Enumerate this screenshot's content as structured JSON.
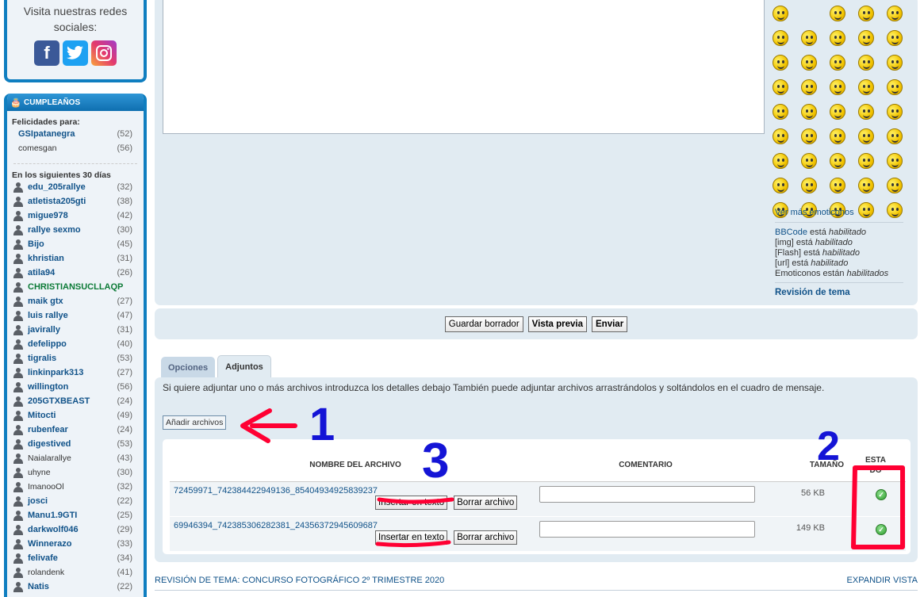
{
  "social": {
    "title": "Visita nuestras redes sociales:",
    "icons": [
      "facebook-icon",
      "twitter-icon",
      "instagram-icon"
    ]
  },
  "birthdays": {
    "header": "CUMPLEAÑOS",
    "today_title": "Felicidades para:",
    "today": [
      {
        "name": "GSIpatanegra",
        "age": "(52)"
      },
      {
        "name": "comesgan",
        "age": "(56)"
      }
    ],
    "upcoming_title": "En los siguientes 30 días",
    "upcoming": [
      {
        "name": "edu_205rallye",
        "age": "(32)",
        "style": "link"
      },
      {
        "name": "atletista205gti",
        "age": "(38)",
        "style": "link"
      },
      {
        "name": "migue978",
        "age": "(42)",
        "style": "link"
      },
      {
        "name": "rallye sexmo",
        "age": "(30)",
        "style": "link"
      },
      {
        "name": "Bijo",
        "age": "(45)",
        "style": "link"
      },
      {
        "name": "khristian",
        "age": "(31)",
        "style": "link"
      },
      {
        "name": "atila94",
        "age": "(26)",
        "style": "link"
      },
      {
        "name": "CHRISTIANSUCLLAQP",
        "age": "",
        "style": "green"
      },
      {
        "name": "maik gtx",
        "age": "(27)",
        "style": "link"
      },
      {
        "name": "luis rallye",
        "age": "(47)",
        "style": "link"
      },
      {
        "name": "javirally",
        "age": "(31)",
        "style": "link"
      },
      {
        "name": "defelippo",
        "age": "(40)",
        "style": "link"
      },
      {
        "name": "tigralis",
        "age": "(53)",
        "style": "link"
      },
      {
        "name": "linkinpark313",
        "age": "(27)",
        "style": "link"
      },
      {
        "name": "willington",
        "age": "(56)",
        "style": "link"
      },
      {
        "name": "205GTXBEAST",
        "age": "(24)",
        "style": "link"
      },
      {
        "name": "Mitocti",
        "age": "(49)",
        "style": "link"
      },
      {
        "name": "rubenfear",
        "age": "(24)",
        "style": "link"
      },
      {
        "name": "digestived",
        "age": "(53)",
        "style": "link"
      },
      {
        "name": "Naialarallye",
        "age": "(43)",
        "style": "plain"
      },
      {
        "name": "uhyne",
        "age": "(30)",
        "style": "plain"
      },
      {
        "name": "ImanooOl",
        "age": "(32)",
        "style": "plain"
      },
      {
        "name": "josci",
        "age": "(22)",
        "style": "link"
      },
      {
        "name": "Manu1.9GTI",
        "age": "(25)",
        "style": "link"
      },
      {
        "name": "darkwolf046",
        "age": "(29)",
        "style": "link"
      },
      {
        "name": "Winnerazo",
        "age": "(33)",
        "style": "link"
      },
      {
        "name": "felivafe",
        "age": "(34)",
        "style": "link"
      },
      {
        "name": "rolandenk",
        "age": "(41)",
        "style": "plain"
      },
      {
        "name": "Natis",
        "age": "(22)",
        "style": "link"
      }
    ]
  },
  "smilies": {
    "more_link": "Ver más emoticonos"
  },
  "bbcode": {
    "lines": [
      {
        "label": "BBCode",
        "text": " está ",
        "state": "habilitado",
        "link": true
      },
      {
        "label": "[img]",
        "text": " está ",
        "state": "habilitado",
        "link": false
      },
      {
        "label": "[Flash]",
        "text": " está ",
        "state": "habilitado",
        "link": false
      },
      {
        "label": "[url]",
        "text": " está ",
        "state": "habilitado",
        "link": false
      },
      {
        "label": "Emoticonos",
        "text": " están ",
        "state": "habilitados",
        "link": false
      }
    ],
    "topic_review": "Revisión de tema"
  },
  "buttons": {
    "save_draft": "Guardar borrador",
    "preview": "Vista previa",
    "submit": "Enviar"
  },
  "tabs": {
    "options": "Opciones",
    "attachments": "Adjuntos"
  },
  "attachments": {
    "help": "Si quiere adjuntar uno o más archivos introduzca los detalles debajo También puede adjuntar archivos arrastrándolos y soltándolos en el cuadro de mensaje.",
    "add_button": "Añadir archivos",
    "columns": {
      "filename": "NOMBRE DEL ARCHIVO",
      "comment": "COMENTARIO",
      "size": "TAMAÑO",
      "status": "ESTADO"
    },
    "files": [
      {
        "name": "72459971_742384422949136_8540493492583923 7",
        "size": "56 KB",
        "insert": "Insertar en texto",
        "delete": "Borrar archivo"
      },
      {
        "name": "69946394_742385306282381_2435637294560968 7",
        "size": "149 KB",
        "insert": "Insertar en texto",
        "delete": "Borrar archivo"
      }
    ]
  },
  "footer": {
    "review": "REVISIÓN DE TEMA: CONCURSO FOTOGRÁFICO 2º TRIMESTRE 2020",
    "expand": "EXPANDIR VISTA"
  },
  "annotations": [
    "1",
    "2",
    "3"
  ],
  "colors": {
    "annotation_red": "#ff0033",
    "annotation_blue": "#1414d6"
  }
}
